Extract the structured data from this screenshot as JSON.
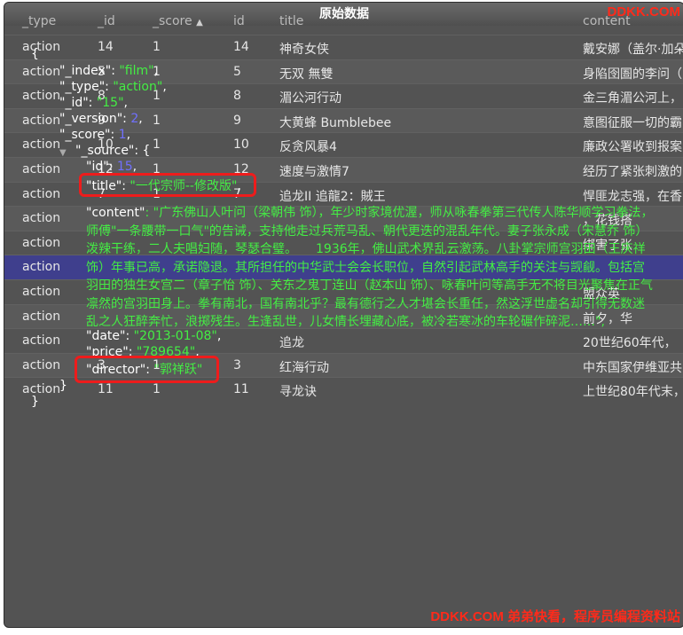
{
  "modal": {
    "title": "原始数据",
    "brand_top": "DDKK.COM",
    "brand_bottom": "DDKK.COM 弟弟快看，程序员编程资料站"
  },
  "background_table": {
    "columns": [
      "_type",
      "_id",
      "_score",
      "id",
      "title",
      "content"
    ],
    "rows": [
      {
        "type": "action",
        "_id": "14",
        "score": "1",
        "id": "14",
        "title": "神奇女侠",
        "content": "戴安娜（盖尔·加朵"
      },
      {
        "type": "action",
        "_id": "5",
        "score": "1",
        "id": "5",
        "title": "无双 無雙",
        "content": "身陷囹圄的李问（"
      },
      {
        "type": "action",
        "_id": "8",
        "score": "1",
        "id": "8",
        "title": "湄公河行动",
        "content": "金三角湄公河上，"
      },
      {
        "type": "action",
        "_id": "9",
        "score": "1",
        "id": "9",
        "title": "大黄蜂 Bumblebee",
        "content": "意图征服一切的霸"
      },
      {
        "type": "action",
        "_id": "10",
        "score": "1",
        "id": "10",
        "title": "反贪风暴4",
        "content": "廉政公署收到报案"
      },
      {
        "type": "action",
        "_id": "12",
        "score": "1",
        "id": "12",
        "title": "速度与激情7",
        "content": "经历了紧张刺激的"
      },
      {
        "type": "action",
        "_id": "7",
        "score": "1",
        "id": "7",
        "title": "追龙II 追龍2：賊王",
        "content": "悍匪龙志强，在香"
      },
      {
        "type": "action",
        "_id": "",
        "score": "",
        "id": "",
        "title": "",
        "content": "，花钱搭"
      },
      {
        "type": "action",
        "_id": "",
        "score": "",
        "id": "",
        "title": "",
        "content": "绑害了张"
      },
      {
        "type": "action",
        "_id": "",
        "score": "",
        "id": "",
        "title": "",
        "content": ""
      },
      {
        "type": "action",
        "_id": "",
        "score": "",
        "id": "",
        "title": "",
        "content": "盟众英"
      },
      {
        "type": "action",
        "_id": "",
        "score": "",
        "id": "",
        "title": "",
        "content": "前夕，华"
      },
      {
        "type": "action",
        "_id": "",
        "score": "",
        "id": "",
        "title": "追龙",
        "content": "20世纪60年代，"
      },
      {
        "type": "action",
        "_id": "3",
        "score": "1",
        "id": "3",
        "title": "红海行动",
        "content": "中东国家伊维亚共"
      },
      {
        "type": "action",
        "_id": "11",
        "score": "1",
        "id": "11",
        "title": "寻龙诀",
        "content": "上世纪80年代末，"
      }
    ]
  },
  "json_view": {
    "open_brace": "{",
    "index_key": "\"_index\"",
    "index_val": "\"film\"",
    "type_key": "\"_type\"",
    "type_val": "\"action\"",
    "id_key": "\"_id\"",
    "id_val": "\"15\"",
    "version_key": "\"_version\"",
    "version_val": "2",
    "score_key": "\"_score\"",
    "score_val": "1",
    "source_key": "\"_source\"",
    "src_id_key": "\"id\"",
    "src_id_val": "15",
    "title_key": "\"title\"",
    "title_val": "\"一代宗师--修改版\"",
    "content_key": "\"content\"",
    "content_val": "\"广东佛山人叶问（梁朝伟 饰），年少时家境优渥，师从咏春拳第三代传人陈华顺学习拳法，师傅\"一条腰带一口气\"的告诫，支持他走过兵荒马乱、朝代更迭的混乱年代。妻子张永成（宋慧乔 饰）泼辣干练，二人夫唱妇随，琴瑟合璧。　　1936年，佛山武术界乱云激荡。八卦掌宗师宫羽田（王庆祥 饰）年事已高，承诺隐退。其所担任的中华武士会会长职位，自然引起武林高手的关注与觊觎。包括宫羽田的独生女宫二（章子怡 饰）、关东之鬼丁连山（赵本山 饰）、咏春叶问等高手无不将目光聚焦在正气凛然的宫羽田身上。拳有南北，国有南北乎？最有德行之人才堪会长重任，然这浮世虚名却引得无数迷乱之人狂醉奔忙，浪掷残生。生逢乱世，儿女情长埋藏心底，被冷若寒冰的车轮碾作碎泥……\"",
    "date_key": "\"date\"",
    "date_val": "\"2013-01-08\"",
    "price_key": "\"price\"",
    "price_val": "\"789654\"",
    "director_key": "\"director\"",
    "director_val": "\"郭祥跃\"",
    "close_inner": "}",
    "close_outer": "}"
  }
}
